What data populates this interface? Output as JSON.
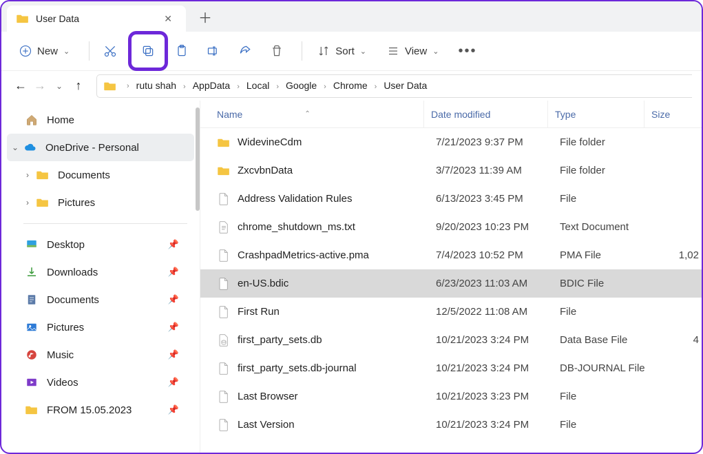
{
  "tab": {
    "title": "User Data"
  },
  "toolbar": {
    "new_label": "New",
    "sort_label": "Sort",
    "view_label": "View"
  },
  "breadcrumbs": [
    "rutu shah",
    "AppData",
    "Local",
    "Google",
    "Chrome",
    "User Data"
  ],
  "sidebar": {
    "home": "Home",
    "onedrive": "OneDrive - Personal",
    "documents": "Documents",
    "pictures": "Pictures",
    "quick": {
      "desktop": "Desktop",
      "downloads": "Downloads",
      "documents": "Documents",
      "pictures": "Pictures",
      "music": "Music",
      "videos": "Videos",
      "from": "FROM 15.05.2023"
    }
  },
  "columns": {
    "name": "Name",
    "date": "Date modified",
    "type": "Type",
    "size": "Size"
  },
  "rows": [
    {
      "name": "WidevineCdm",
      "date": "7/21/2023 9:37 PM",
      "type": "File folder",
      "size": "",
      "icon": "folder",
      "selected": false
    },
    {
      "name": "ZxcvbnData",
      "date": "3/7/2023 11:39 AM",
      "type": "File folder",
      "size": "",
      "icon": "folder",
      "selected": false
    },
    {
      "name": "Address Validation Rules",
      "date": "6/13/2023 3:45 PM",
      "type": "File",
      "size": "",
      "icon": "file",
      "selected": false
    },
    {
      "name": "chrome_shutdown_ms.txt",
      "date": "9/20/2023 10:23 PM",
      "type": "Text Document",
      "size": "",
      "icon": "text",
      "selected": false
    },
    {
      "name": "CrashpadMetrics-active.pma",
      "date": "7/4/2023 10:52 PM",
      "type": "PMA File",
      "size": "1,02",
      "icon": "file",
      "selected": false
    },
    {
      "name": "en-US.bdic",
      "date": "6/23/2023 11:03 AM",
      "type": "BDIC File",
      "size": "",
      "icon": "file",
      "selected": true
    },
    {
      "name": "First Run",
      "date": "12/5/2022 11:08 AM",
      "type": "File",
      "size": "",
      "icon": "file",
      "selected": false
    },
    {
      "name": "first_party_sets.db",
      "date": "10/21/2023 3:24 PM",
      "type": "Data Base File",
      "size": "4",
      "icon": "db",
      "selected": false
    },
    {
      "name": "first_party_sets.db-journal",
      "date": "10/21/2023 3:24 PM",
      "type": "DB-JOURNAL File",
      "size": "",
      "icon": "file",
      "selected": false
    },
    {
      "name": "Last Browser",
      "date": "10/21/2023 3:23 PM",
      "type": "File",
      "size": "",
      "icon": "file",
      "selected": false
    },
    {
      "name": "Last Version",
      "date": "10/21/2023 3:24 PM",
      "type": "File",
      "size": "",
      "icon": "file",
      "selected": false
    }
  ]
}
